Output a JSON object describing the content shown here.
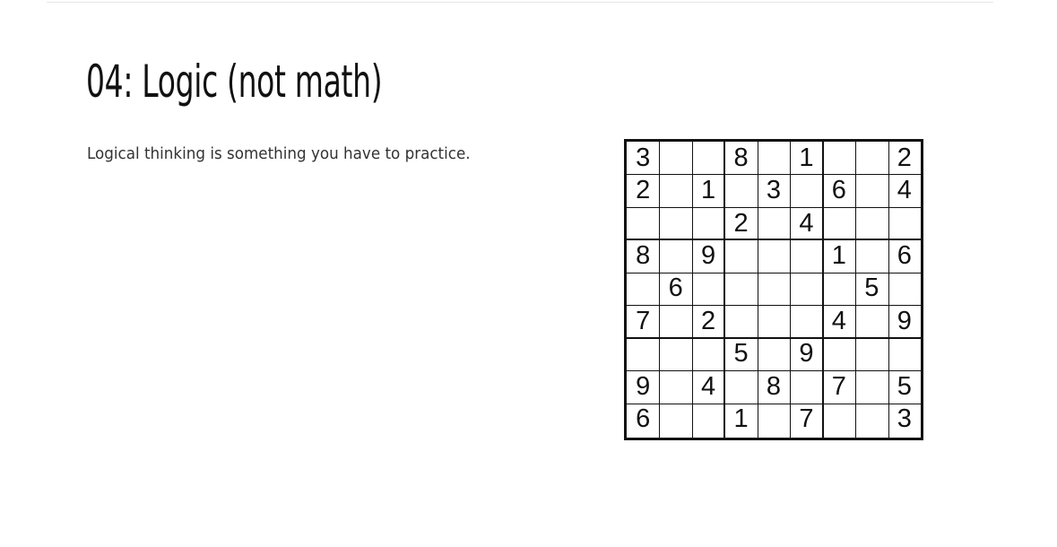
{
  "slide": {
    "title": "04: Logic (not math)",
    "body": "Logical thinking is something you have to practice."
  },
  "sudoku": {
    "grid": [
      [
        "3",
        "",
        "",
        "8",
        "",
        "1",
        "",
        "",
        "2"
      ],
      [
        "2",
        "",
        "1",
        "",
        "3",
        "",
        "6",
        "",
        "4"
      ],
      [
        "",
        "",
        "",
        "2",
        "",
        "4",
        "",
        "",
        ""
      ],
      [
        "8",
        "",
        "9",
        "",
        "",
        "",
        "1",
        "",
        "6"
      ],
      [
        "",
        "6",
        "",
        "",
        "",
        "",
        "",
        "5",
        ""
      ],
      [
        "7",
        "",
        "2",
        "",
        "",
        "",
        "4",
        "",
        "9"
      ],
      [
        "",
        "",
        "",
        "5",
        "",
        "9",
        "",
        "",
        ""
      ],
      [
        "9",
        "",
        "4",
        "",
        "8",
        "",
        "7",
        "",
        "5"
      ],
      [
        "6",
        "",
        "",
        "1",
        "",
        "7",
        "",
        "",
        "3"
      ]
    ]
  }
}
